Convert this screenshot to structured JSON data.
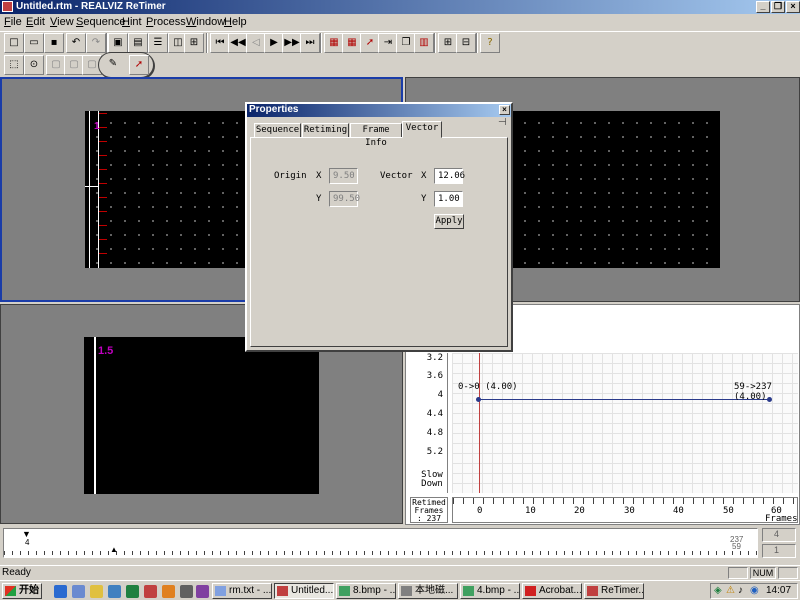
{
  "window": {
    "title": "Untitled.rtm - REALVIZ ReTimer"
  },
  "menu": [
    {
      "label": "File",
      "key": "F",
      "rest": "ile"
    },
    {
      "label": "Edit",
      "key": "E",
      "rest": "dit"
    },
    {
      "label": "View",
      "key": "V",
      "rest": "iew"
    },
    {
      "label": "Sequence",
      "key": "S",
      "rest": "equence"
    },
    {
      "label": "Hint",
      "key": "H",
      "rest": "int"
    },
    {
      "label": "Process",
      "key": "P",
      "rest": "rocess"
    },
    {
      "label": "Window",
      "key": "W",
      "rest": "indow"
    },
    {
      "label": "Help",
      "key": "H",
      "rest": "elp"
    }
  ],
  "viewer": {
    "top_left_marker": "1",
    "bottom_left_marker": "1.5"
  },
  "properties": {
    "title": "Properties",
    "tabs": [
      "Sequence",
      "Retiming",
      "Frame Info",
      "Vector"
    ],
    "active_tab": "Vector",
    "origin_label": "Origin",
    "origin_x_label": "X",
    "origin_y_label": "Y",
    "origin_x": "9.50",
    "origin_y": "99.50",
    "vector_label": "Vector",
    "vector_x_label": "X",
    "vector_y_label": "Y",
    "vector_x": "12.06",
    "vector_y": "1.00",
    "apply_label": "Apply"
  },
  "graph": {
    "y_ticks": [
      "3.2",
      "3.6",
      "4",
      "4.4",
      "4.8",
      "5.2"
    ],
    "slow_down_label": "Slow Down",
    "key_start": "0->0 (4.00)",
    "key_end": "59->237 (4.00)",
    "retimed_label": "Retimed Frames : 237",
    "x_ticks": [
      "0",
      "10",
      "20",
      "30",
      "40",
      "50",
      "60"
    ],
    "x_unit": "Frames"
  },
  "timeline": {
    "start_mark": "4",
    "end_top": "237",
    "end_bottom": "59",
    "box1": "4",
    "box2": "1"
  },
  "status": {
    "text": "Ready",
    "num": "NUM"
  },
  "taskbar": {
    "start": "开始",
    "tasks": [
      "rm.txt - ...",
      "Untitled...",
      "8.bmp - ...",
      "本地磁...",
      "4.bmp - ...",
      "Acrobat...",
      "ReTimer..."
    ],
    "clock": "14:07"
  }
}
